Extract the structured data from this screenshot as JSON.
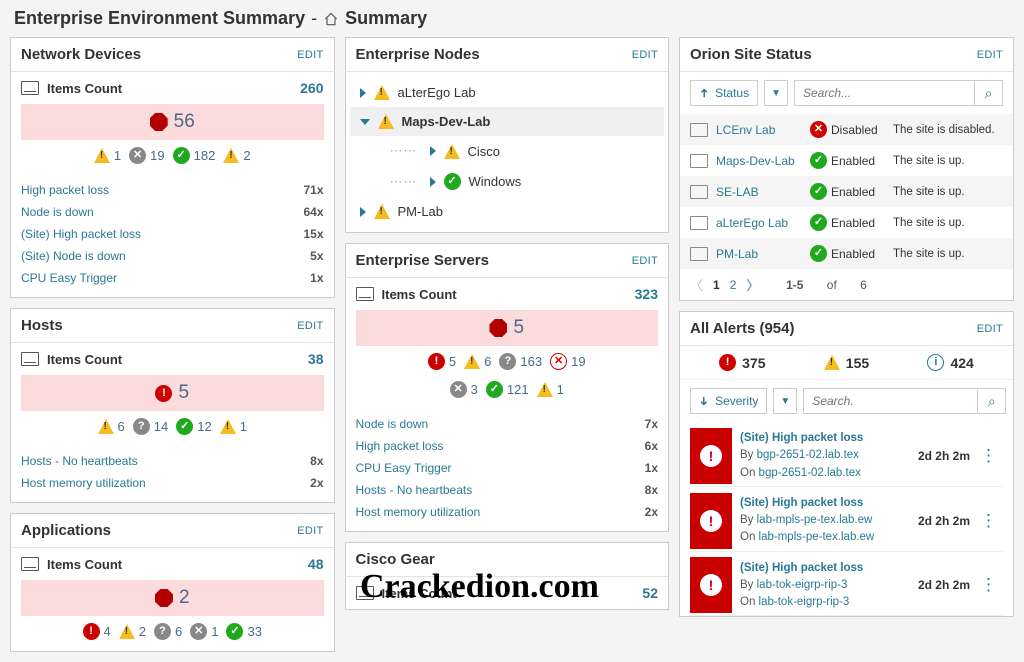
{
  "title_pre": "Enterprise Environment Summary",
  "title_post": "Summary",
  "edit": "EDIT",
  "items_count_label": "Items Count",
  "widgets": {
    "nd": {
      "title": "Network Devices",
      "count": "260",
      "big": "56",
      "stats": [
        {
          "k": "warn",
          "v": "1"
        },
        {
          "k": "gray",
          "v": "19"
        },
        {
          "k": "ok",
          "v": "182"
        },
        {
          "k": "warn",
          "v": "2"
        }
      ],
      "rows": [
        [
          "High packet loss",
          "71x"
        ],
        [
          "Node is down",
          "64x"
        ],
        [
          "(Site) High packet loss",
          "15x"
        ],
        [
          "(Site) Node is down",
          "5x"
        ],
        [
          "CPU Easy Trigger",
          "1x"
        ]
      ]
    },
    "hosts": {
      "title": "Hosts",
      "count": "38",
      "big": "5",
      "stats": [
        {
          "k": "warn",
          "v": "6"
        },
        {
          "k": "q",
          "v": "14"
        },
        {
          "k": "ok",
          "v": "12"
        },
        {
          "k": "warn",
          "v": "1"
        }
      ],
      "rows": [
        [
          "Hosts - No heartbeats",
          "8x"
        ],
        [
          "Host memory utilization",
          "2x"
        ]
      ]
    },
    "apps": {
      "title": "Applications",
      "count": "48",
      "big": "2",
      "stats": [
        {
          "k": "crit",
          "v": "4"
        },
        {
          "k": "warn",
          "v": "2"
        },
        {
          "k": "q",
          "v": "6"
        },
        {
          "k": "gray",
          "v": "1"
        },
        {
          "k": "ok",
          "v": "33"
        }
      ]
    },
    "en": {
      "title": "Enterprise Nodes",
      "tree": [
        {
          "t": "aLterEgo Lab",
          "lv": 0,
          "exp": false,
          "ic": "warn"
        },
        {
          "t": "Maps-Dev-Lab",
          "lv": 0,
          "exp": true,
          "sel": true,
          "ic": "warn"
        },
        {
          "t": "Cisco",
          "lv": 1,
          "ic": "warn"
        },
        {
          "t": "Windows",
          "lv": 1,
          "ic": "ok"
        },
        {
          "t": "PM-Lab",
          "lv": 0,
          "exp": false,
          "ic": "warn"
        }
      ]
    },
    "es": {
      "title": "Enterprise Servers",
      "count": "323",
      "big": "5",
      "stats1": [
        {
          "k": "crit",
          "v": "5"
        },
        {
          "k": "warn",
          "v": "6"
        },
        {
          "k": "q",
          "v": "163"
        },
        {
          "k": "rx",
          "v": "19"
        }
      ],
      "stats2": [
        {
          "k": "gray",
          "v": "3"
        },
        {
          "k": "ok",
          "v": "121"
        },
        {
          "k": "warn",
          "v": "1"
        }
      ],
      "rows": [
        [
          "Node is down",
          "7x"
        ],
        [
          "High packet loss",
          "6x"
        ],
        [
          "CPU Easy Trigger",
          "1x"
        ],
        [
          "Hosts - No heartbeats",
          "8x"
        ],
        [
          "Host memory utilization",
          "2x"
        ]
      ]
    },
    "cg": {
      "title": "Cisco Gear",
      "count": "52"
    }
  },
  "site": {
    "title": "Orion Site Status",
    "filter_label": "Status",
    "search_ph": "Search...",
    "rows": [
      {
        "name": "LCEnv Lab",
        "status": "Disabled",
        "msg": "The site is disabled.",
        "ok": false
      },
      {
        "name": "Maps-Dev-Lab",
        "status": "Enabled",
        "msg": "The site is up.",
        "ok": true
      },
      {
        "name": "SE-LAB",
        "status": "Enabled",
        "msg": "The site is up.",
        "ok": true
      },
      {
        "name": "aLterEgo Lab",
        "status": "Enabled",
        "msg": "The site is up.",
        "ok": true
      },
      {
        "name": "PM-Lab",
        "status": "Enabled",
        "msg": "The site is up.",
        "ok": true
      }
    ],
    "pager": {
      "p1": "1",
      "p2": "2",
      "range": "1-5",
      "of": "of",
      "tot": "6"
    }
  },
  "alerts": {
    "title": "All Alerts (954)",
    "sum": {
      "crit": "375",
      "warn": "155",
      "info": "424"
    },
    "filter_label": "Severity",
    "search_ph": "Search.",
    "rows": [
      {
        "t": "(Site) High packet loss",
        "by": "bgp-2651-02.lab.tex",
        "on": "bgp-2651-02.lab.tex",
        "time": "2d 2h 2m"
      },
      {
        "t": "(Site) High packet loss",
        "by": "lab-mpls-pe-tex.lab.ew",
        "on": "lab-mpls-pe-tex.lab.ew",
        "time": "2d 2h 2m"
      },
      {
        "t": "(Site) High packet loss",
        "by": "lab-tok-eigrp-rip-3",
        "on": "lab-tok-eigrp-rip-3",
        "time": "2d 2h 2m"
      }
    ]
  },
  "watermark": "Crackedion.com"
}
